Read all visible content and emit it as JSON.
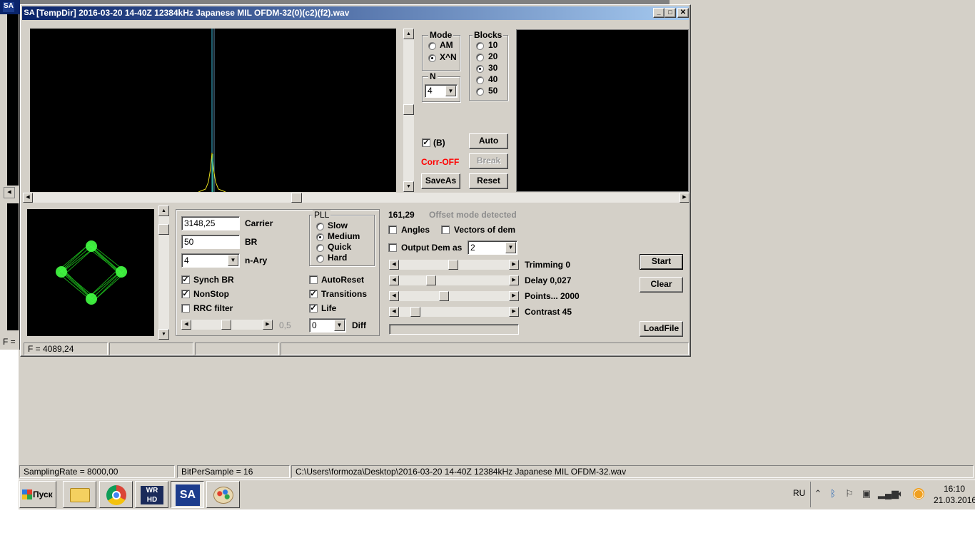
{
  "window": {
    "title": "[TempDir] 2016-03-20 14-40Z 12384kHz Japanese MIL OFDM-32(0)(c2)(f2).wav",
    "bg_title_fragment": "[TempDir] 2016-03-20 14-40Z 12384kHz Japanese MIL OFDM-32(0)(c2)(f2).wav"
  },
  "mode_group": {
    "title": "Mode",
    "options": [
      "AM",
      "X^N"
    ],
    "selected": "X^N"
  },
  "blocks_group": {
    "title": "Blocks",
    "options": [
      "10",
      "20",
      "30",
      "40",
      "50"
    ],
    "selected": "30"
  },
  "n_group": {
    "title": "N",
    "value": "4"
  },
  "b_checkbox": {
    "label": "(B)",
    "checked": true
  },
  "corr_status": {
    "text": "Corr-OFF",
    "color": "#ff0000"
  },
  "buttons": {
    "auto": "Auto",
    "break": "Break",
    "saveas": "SaveAs",
    "reset": "Reset",
    "start": "Start",
    "clear": "Clear",
    "loadfile": "LoadFile"
  },
  "params": {
    "carrier_value": "3148,25",
    "carrier_label": "Carrier",
    "br_value": "50",
    "br_label": "BR",
    "nary_value": "4",
    "nary_label": "n-Ary"
  },
  "pll_group": {
    "title": "PLL",
    "options": [
      "Slow",
      "Medium",
      "Quick",
      "Hard"
    ],
    "selected": "Medium"
  },
  "left_checks": [
    {
      "label": "Synch BR",
      "checked": true
    },
    {
      "label": "NonStop",
      "checked": true
    },
    {
      "label": "RRC filter",
      "checked": false
    }
  ],
  "right_checks": [
    {
      "label": "AutoReset",
      "checked": false
    },
    {
      "label": "Transitions",
      "checked": true
    },
    {
      "label": "Life",
      "checked": true
    }
  ],
  "rrc_value": "0,5",
  "diff": {
    "value": "0",
    "label": "Diff"
  },
  "demod": {
    "offset_value": "161,29",
    "offset_message": "Offset mode detected",
    "angles_label": "Angles",
    "angles_checked": false,
    "vectors_label": "Vectors of dem",
    "vectors_checked": false,
    "output_label": "Output Dem as",
    "output_checked": false,
    "output_value": "2"
  },
  "sliders": [
    {
      "label": "Trimming 0",
      "level": 0.55
    },
    {
      "label": "Delay  0,027",
      "level": 0.3
    },
    {
      "label": "Points... 2000",
      "level": 0.45
    },
    {
      "label": "Contrast 45",
      "level": 0.1
    }
  ],
  "window_status": {
    "frequency": "F = 4089,24"
  },
  "app_status": {
    "sampling_rate": "SamplingRate = 8000,00",
    "bits": "BitPerSample = 16",
    "file_path": "C:\\Users\\formoza\\Desktop\\2016-03-20 14-40Z 12384kHz Japanese MIL OFDM-32.wav"
  },
  "taskbar": {
    "start_label": "Пуск",
    "lang": "RU",
    "time": "16:10",
    "date": "21.03.2016"
  },
  "colors": {
    "title_gradient_start": "#0a246a",
    "title_gradient_end": "#a6caf0",
    "constellation": "#22dd22",
    "spectrum_peak": "#e8e020",
    "spectrum_marker": "#40c0e0"
  }
}
